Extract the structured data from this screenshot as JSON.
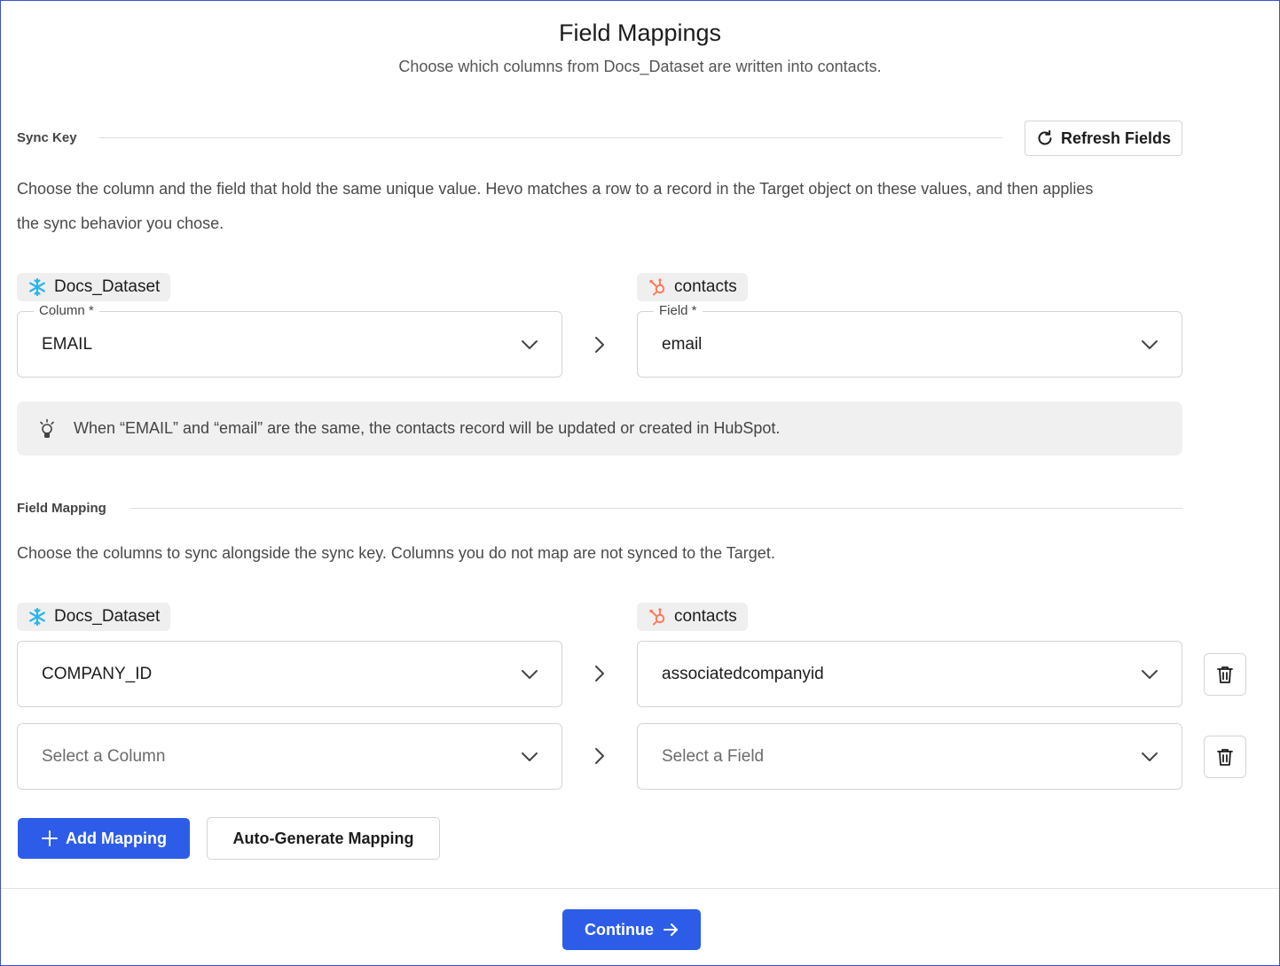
{
  "page": {
    "title": "Field Mappings",
    "subtitle": "Choose which columns from Docs_Dataset are written into contacts."
  },
  "sync_key": {
    "section_label": "Sync Key",
    "refresh_label": "Refresh Fields",
    "description_line1": "Choose the column and the field that hold the same unique value. Hevo matches a row to a record in the Target object on these values, and then applies",
    "description_line2": "the sync behavior you chose.",
    "source_name": "Docs_Dataset",
    "target_name": "contacts",
    "column_label": "Column *",
    "column_value": "EMAIL",
    "field_label": "Field *",
    "field_value": "email",
    "hint": "When “EMAIL” and “email” are the same, the contacts record will be updated or created in HubSpot."
  },
  "field_mapping": {
    "section_label": "Field Mapping",
    "description": "Choose the columns to sync alongside the sync key. Columns you do not map are not synced to the Target.",
    "source_name": "Docs_Dataset",
    "target_name": "contacts",
    "rows": [
      {
        "column": "COMPANY_ID",
        "field": "associatedcompanyid"
      },
      {
        "column_placeholder": "Select a Column",
        "field_placeholder": "Select a Field"
      }
    ],
    "add_label": "Add Mapping",
    "auto_label": "Auto-Generate Mapping"
  },
  "footer": {
    "continue_label": "Continue"
  },
  "colors": {
    "primary": "#2d5de8",
    "snowflake": "#29b5e8",
    "hubspot": "#ff7a59"
  }
}
